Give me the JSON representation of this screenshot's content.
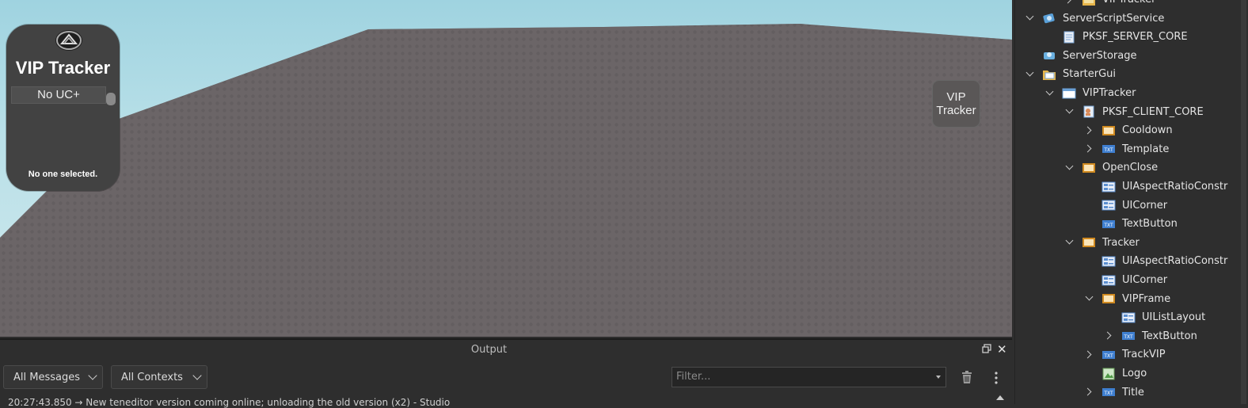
{
  "viewport": {
    "vip_panel": {
      "title": "VIP Tracker",
      "item_label": "No UC+",
      "status": "No one selected."
    },
    "vip_button_label_1": "VIP",
    "vip_button_label_2": "Tracker"
  },
  "output": {
    "title": "Output",
    "messages_filter": "All Messages",
    "contexts_filter": "All Contexts",
    "filter_placeholder": "Filter...",
    "log_line": "20:27:43.850  →  New teneditor version coming online; unloading the old version (x2)  -  Studio"
  },
  "explorer": {
    "rows": [
      {
        "label": "VIPTracker",
        "indent": 2,
        "twisty": "right",
        "icon": "folder-icon"
      },
      {
        "label": "ServerScriptService",
        "indent": 0,
        "twisty": "down",
        "icon": "server-script-service-icon"
      },
      {
        "label": "PKSF_SERVER_CORE",
        "indent": 1,
        "twisty": "",
        "icon": "script-icon"
      },
      {
        "label": "ServerStorage",
        "indent": 0,
        "twisty": "",
        "icon": "server-storage-icon"
      },
      {
        "label": "StarterGui",
        "indent": 0,
        "twisty": "down",
        "icon": "starter-gui-icon"
      },
      {
        "label": "VIPTracker",
        "indent": 1,
        "twisty": "down",
        "icon": "screen-gui-icon"
      },
      {
        "label": "PKSF_CLIENT_CORE",
        "indent": 2,
        "twisty": "down",
        "icon": "local-script-icon"
      },
      {
        "label": "Cooldown",
        "indent": 3,
        "twisty": "right",
        "icon": "frame-icon"
      },
      {
        "label": "Template",
        "indent": 3,
        "twisty": "right",
        "icon": "text-label-icon"
      },
      {
        "label": "OpenClose",
        "indent": 2,
        "twisty": "down",
        "icon": "frame-icon"
      },
      {
        "label": "UIAspectRatioConstr",
        "indent": 3,
        "twisty": "",
        "icon": "ui-constraint-icon"
      },
      {
        "label": "UICorner",
        "indent": 3,
        "twisty": "",
        "icon": "ui-constraint-icon"
      },
      {
        "label": "TextButton",
        "indent": 3,
        "twisty": "",
        "icon": "text-button-icon"
      },
      {
        "label": "Tracker",
        "indent": 2,
        "twisty": "down",
        "icon": "frame-icon"
      },
      {
        "label": "UIAspectRatioConstr",
        "indent": 3,
        "twisty": "",
        "icon": "ui-constraint-icon"
      },
      {
        "label": "UICorner",
        "indent": 3,
        "twisty": "",
        "icon": "ui-constraint-icon"
      },
      {
        "label": "VIPFrame",
        "indent": 3,
        "twisty": "down",
        "icon": "frame-icon"
      },
      {
        "label": "UIListLayout",
        "indent": 4,
        "twisty": "",
        "icon": "ui-constraint-icon"
      },
      {
        "label": "TextButton",
        "indent": 4,
        "twisty": "right",
        "icon": "text-button-icon"
      },
      {
        "label": "TrackVIP",
        "indent": 3,
        "twisty": "right",
        "icon": "text-button-icon"
      },
      {
        "label": "Logo",
        "indent": 3,
        "twisty": "",
        "icon": "image-label-icon"
      },
      {
        "label": "Title",
        "indent": 3,
        "twisty": "right",
        "icon": "text-label-icon"
      }
    ]
  }
}
